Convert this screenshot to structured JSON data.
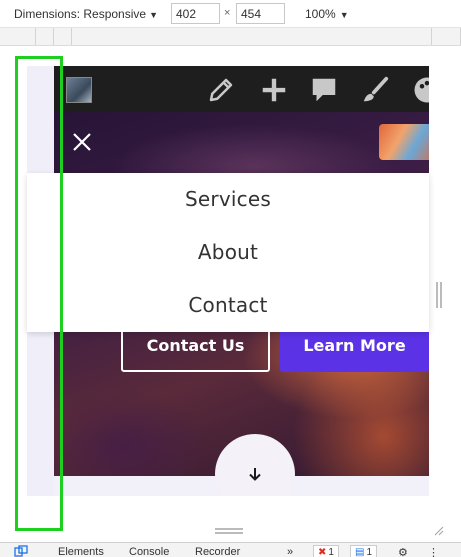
{
  "toolbar": {
    "dimensions_label": "Dimensions: Responsive",
    "width_value": "402",
    "times_symbol": "×",
    "height_value": "454",
    "zoom_label": "100%"
  },
  "admin_bar": {
    "icons": [
      "pencil-icon",
      "plus-icon",
      "comment-icon",
      "brush-icon",
      "palette-icon"
    ]
  },
  "nav_menu": {
    "items": [
      "Services",
      "About",
      "Contact"
    ]
  },
  "hero": {
    "primary_button": "Contact Us",
    "secondary_button": "Learn More"
  },
  "devtools": {
    "tabs": [
      "Elements",
      "Console",
      "Recorder",
      "»"
    ],
    "error_count": "1",
    "message_count": "1"
  },
  "colors": {
    "accent_button": "#5b32e6",
    "highlight_box": "#1fcf1f",
    "admin_bar": "#1e1e1e"
  }
}
